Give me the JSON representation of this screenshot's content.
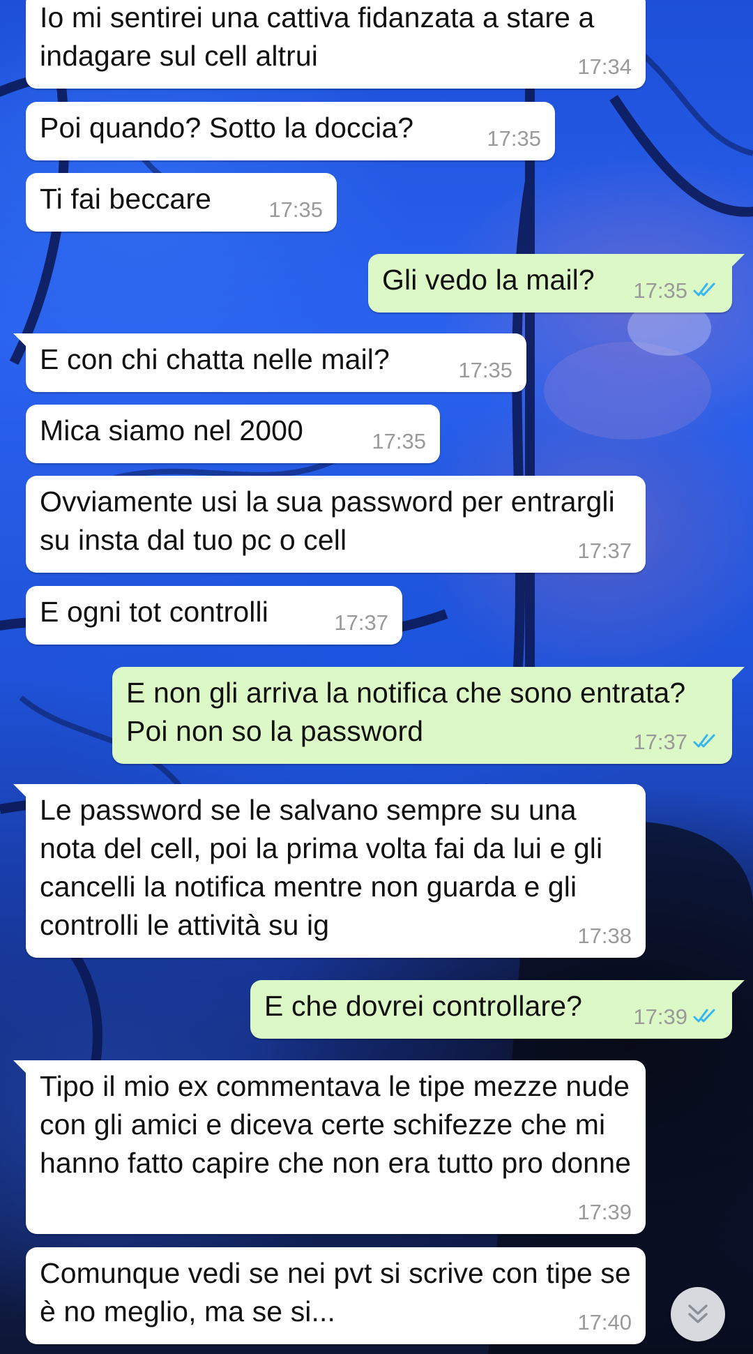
{
  "theme": {
    "incoming_bubble": "#ffffff",
    "outgoing_bubble": "#dcf8c6",
    "time_color": "#9a9a9a",
    "read_ticks_color": "#34b7f1"
  },
  "messages": [
    {
      "direction": "in",
      "text": "Io mi sentirei una cattiva fidanzata a stare a indagare sul cell altrui",
      "time": "17:34"
    },
    {
      "direction": "in",
      "text": "Poi quando? Sotto la doccia?",
      "time": "17:35"
    },
    {
      "direction": "in",
      "text": "Ti fai beccare",
      "time": "17:35"
    },
    {
      "direction": "out",
      "text": "Gli vedo la mail?",
      "time": "17:35",
      "status": "read"
    },
    {
      "direction": "in",
      "text": "E con chi chatta nelle mail?",
      "time": "17:35"
    },
    {
      "direction": "in",
      "text": "Mica siamo nel 2000",
      "time": "17:35"
    },
    {
      "direction": "in",
      "text": "Ovviamente usi la sua password per entrargli su insta dal tuo pc o cell",
      "time": "17:37"
    },
    {
      "direction": "in",
      "text": "E ogni tot controlli",
      "time": "17:37"
    },
    {
      "direction": "out",
      "text": "E non gli arriva la notifica che sono entrata? Poi non so la password",
      "time": "17:37",
      "status": "read"
    },
    {
      "direction": "in",
      "text": "Le password se le salvano sempre su una nota del cell, poi la prima volta fai da lui e gli cancelli la notifica mentre non guarda e gli controlli le attività su ig",
      "time": "17:38"
    },
    {
      "direction": "out",
      "text": "E che dovrei controllare?",
      "time": "17:39",
      "status": "read"
    },
    {
      "direction": "in",
      "text": "Tipo il mio ex commentava le tipe mezze nude con gli amici e diceva certe schifezze che mi hanno fatto capire che non era tutto pro donne",
      "time": "17:39"
    },
    {
      "direction": "in",
      "text": "Comunque vedi se nei pvt si scrive con tipe se è no meglio, ma se si...",
      "time": "17:40"
    }
  ],
  "scroll_button": {
    "icon": "double-chevron-down-icon"
  }
}
